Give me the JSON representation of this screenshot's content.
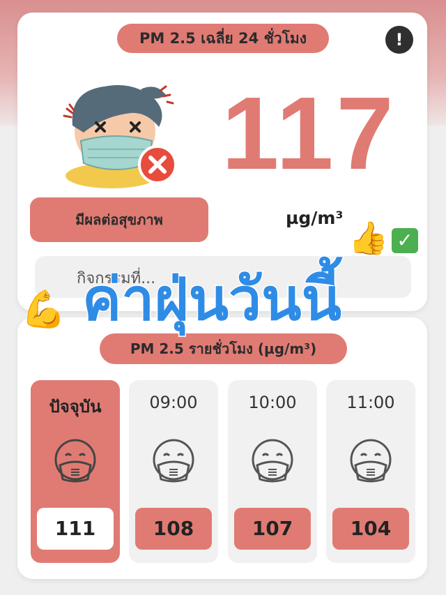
{
  "header": {
    "title": "PM 2.5 เฉลี่ย 24 ชั่วโมง",
    "info_icon": "!"
  },
  "current": {
    "value": "117",
    "unit": "µg/m³",
    "status": "มีผลต่อสุขภาพ",
    "advice": "กิจกรรมที่..."
  },
  "overlay": {
    "text": "ค่าฝุ่นวันนี้"
  },
  "hourly": {
    "title": "PM 2.5 รายชั่วโมง  (µg/m³)",
    "tiles": [
      {
        "label": "ปัจจุบัน",
        "value": "111"
      },
      {
        "label": "09:00",
        "value": "108"
      },
      {
        "label": "10:00",
        "value": "107"
      },
      {
        "label": "11:00",
        "value": "104"
      }
    ]
  },
  "colors": {
    "accent": "#e07b74",
    "overlay_text": "#2f8ce6"
  }
}
